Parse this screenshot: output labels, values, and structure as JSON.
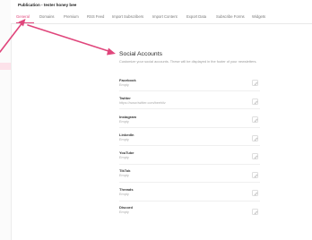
{
  "header": {
    "title": "Publication - tester honey bee"
  },
  "tabs": [
    {
      "label": "General",
      "active": true
    },
    {
      "label": "Domains",
      "active": false
    },
    {
      "label": "Premium",
      "active": false
    },
    {
      "label": "RSS Feed",
      "active": false
    },
    {
      "label": "Import Subscribers",
      "active": false
    },
    {
      "label": "Import Content",
      "active": false
    },
    {
      "label": "Export Data",
      "active": false
    },
    {
      "label": "Subscribe Forms",
      "active": false
    },
    {
      "label": "Widgets",
      "active": false
    }
  ],
  "section": {
    "title": "Social Accounts",
    "description": "Customize your social accounts. These will be displayed in the footer of your newsletters."
  },
  "accounts": [
    {
      "label": "Facebook",
      "value": "Empty"
    },
    {
      "label": "Twitter",
      "value": "https://www.twitter.com/beehiiv"
    },
    {
      "label": "Instagram",
      "value": "Empty"
    },
    {
      "label": "LinkedIn",
      "value": "Empty"
    },
    {
      "label": "YouTube",
      "value": "Empty"
    },
    {
      "label": "TikTok",
      "value": "Empty"
    },
    {
      "label": "Threads",
      "value": "Empty"
    },
    {
      "label": "Discord",
      "value": "Empty"
    }
  ],
  "colors": {
    "accent": "#e0467c",
    "arrow": "#e0467c"
  },
  "icons": {
    "edit": "pencil-icon"
  }
}
